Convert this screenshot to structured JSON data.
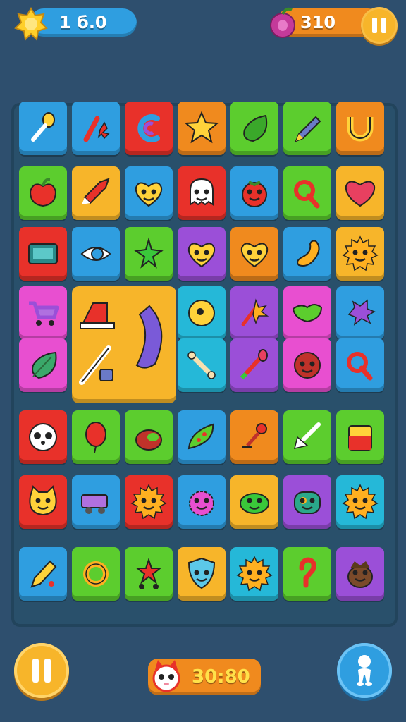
{
  "hud": {
    "coins": "1 б.0",
    "score": "310",
    "timer": "30:80"
  },
  "icons": {
    "coin": "star-coin-icon",
    "fruit": "berry-icon",
    "timer": "cat-face-icon",
    "pause": "pause-icon",
    "hint": "hint-figure-icon"
  },
  "colors": {
    "background": "#2e4f6e",
    "blue": "#2f9ee0",
    "orange": "#f08a1e",
    "yellow": "#f7b52a",
    "red": "#e8312a",
    "green": "#5ccd2e",
    "purple": "#9b4fd8",
    "magenta": "#e84fd0",
    "cyan": "#25b8d8"
  },
  "board": {
    "rows": [
      [
        {
          "color": "blue",
          "icon": "spoon-icon"
        },
        {
          "color": "blue",
          "icon": "spark-tool-icon"
        },
        {
          "color": "red",
          "icon": "spiral-c-icon"
        },
        {
          "color": "orange",
          "icon": "star-icon"
        },
        {
          "color": "green",
          "icon": "leaf-drop-icon"
        },
        {
          "color": "green",
          "icon": "pen-icon"
        },
        {
          "color": "orange",
          "icon": "horseshoe-icon"
        }
      ],
      [
        {
          "color": "green",
          "icon": "apple-icon"
        },
        {
          "color": "yellow",
          "icon": "rocket-icon"
        },
        {
          "color": "blue",
          "icon": "heart-face-icon"
        },
        {
          "color": "red",
          "icon": "ghost-face-icon"
        },
        {
          "color": "blue",
          "icon": "tomato-face-icon"
        },
        {
          "color": "green",
          "icon": "q-shape-icon"
        },
        {
          "color": "yellow",
          "icon": "heart-icon"
        }
      ],
      [
        {
          "color": "red",
          "icon": "tv-icon"
        },
        {
          "color": "blue",
          "icon": "eye-icon"
        },
        {
          "color": "green",
          "icon": "star-leaf-icon"
        },
        {
          "color": "purple",
          "icon": "heart-face-icon"
        },
        {
          "color": "orange",
          "icon": "heart-face-icon"
        },
        {
          "color": "blue",
          "icon": "bean-icon"
        },
        {
          "color": "yellow",
          "icon": "sun-face-icon"
        }
      ],
      [
        {
          "color": "magenta",
          "icon": "cart-icon"
        },
        {
          "color": "yellow",
          "icon": "big-tile"
        },
        {
          "color": "yellow",
          "icon": "big-tile"
        },
        {
          "color": "cyan",
          "icon": "orb-icon"
        },
        {
          "color": "purple",
          "icon": "rocket-spark-icon"
        },
        {
          "color": "magenta",
          "icon": "slime-icon"
        },
        {
          "color": "blue",
          "icon": "splat-icon"
        }
      ],
      [
        {
          "color": "magenta",
          "icon": "leaf-icon"
        },
        {
          "color": "yellow",
          "icon": "big-tile"
        },
        {
          "color": "yellow",
          "icon": "big-tile"
        },
        {
          "color": "cyan",
          "icon": "bone-icon"
        },
        {
          "color": "purple",
          "icon": "brush-icon"
        },
        {
          "color": "magenta",
          "icon": "ball-face-icon"
        },
        {
          "color": "blue",
          "icon": "q-shape-icon"
        }
      ],
      [
        {
          "color": "red",
          "icon": "panda-face-icon"
        },
        {
          "color": "green",
          "icon": "balloon-icon"
        },
        {
          "color": "green",
          "icon": "coconut-icon"
        },
        {
          "color": "blue",
          "icon": "pod-icon"
        },
        {
          "color": "orange",
          "icon": "plunger-icon"
        },
        {
          "color": "green",
          "icon": "arrow-icon"
        },
        {
          "color": "green",
          "icon": "jam-jar-icon"
        }
      ],
      [
        {
          "color": "red",
          "icon": "cat-face-icon"
        },
        {
          "color": "blue",
          "icon": "van-icon"
        },
        {
          "color": "red",
          "icon": "sun-face-icon"
        },
        {
          "color": "blue",
          "icon": "fuzzball-icon"
        },
        {
          "color": "yellow",
          "icon": "frog-face-icon"
        },
        {
          "color": "purple",
          "icon": "monster-face-icon"
        },
        {
          "color": "cyan",
          "icon": "sun-face-icon"
        }
      ],
      [
        {
          "color": "blue",
          "icon": "pencil-icon"
        },
        {
          "color": "green",
          "icon": "ring-icon"
        },
        {
          "color": "green",
          "icon": "star-cart-icon"
        },
        {
          "color": "yellow",
          "icon": "shield-face-icon"
        },
        {
          "color": "cyan",
          "icon": "sun-face-icon"
        },
        {
          "color": "green",
          "icon": "hook-icon"
        },
        {
          "color": "purple",
          "icon": "acorn-face-icon"
        }
      ]
    ]
  }
}
